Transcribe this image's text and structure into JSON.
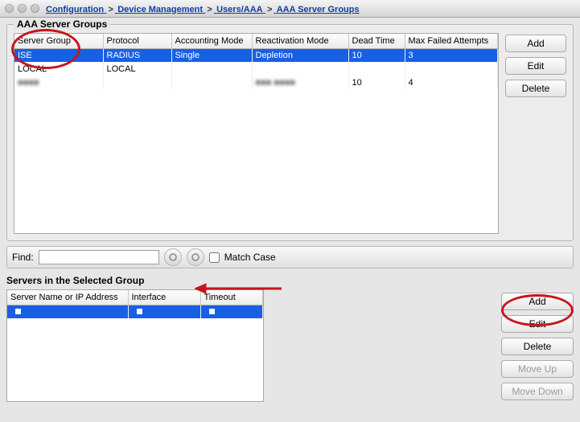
{
  "breadcrumb": {
    "a": "Configuration",
    "b": "Device Management",
    "c": "Users/AAA",
    "d": "AAA Server Groups",
    "sep": ">"
  },
  "groups_box_title": "AAA Server Groups",
  "groups_table": {
    "headers": {
      "server_group": "Server Group",
      "protocol": "Protocol",
      "accounting_mode": "Accounting Mode",
      "reactivation_mode": "Reactivation Mode",
      "dead_time": "Dead Time",
      "max_failed": "Max Failed Attempts"
    },
    "rows": [
      {
        "server_group": "ISE",
        "protocol": "RADIUS",
        "accounting_mode": "Single",
        "reactivation_mode": "Depletion",
        "dead_time": "10",
        "max_failed": "3",
        "selected": true
      },
      {
        "server_group": "LOCAL",
        "protocol": "LOCAL",
        "accounting_mode": "",
        "reactivation_mode": "",
        "dead_time": "",
        "max_failed": "",
        "selected": false
      },
      {
        "server_group": "■■■■",
        "protocol": "",
        "accounting_mode": "",
        "reactivation_mode": "■■■ ■■■■",
        "dead_time": "10",
        "max_failed": "4",
        "selected": false,
        "obscured": true
      }
    ]
  },
  "groups_buttons": {
    "add": "Add",
    "edit": "Edit",
    "delete": "Delete"
  },
  "find": {
    "label": "Find:",
    "value": "",
    "match_case": "Match Case"
  },
  "servers_section_title": "Servers in the Selected Group",
  "servers_table": {
    "headers": {
      "server": "Server Name or IP Address",
      "interface": "Interface",
      "timeout": "Timeout"
    },
    "rows": [
      {
        "server": "",
        "interface": "",
        "timeout": "",
        "selected": true
      }
    ]
  },
  "servers_buttons": {
    "add": "Add",
    "edit": "Edit",
    "delete": "Delete",
    "move_up": "Move Up",
    "move_down": "Move Down"
  }
}
